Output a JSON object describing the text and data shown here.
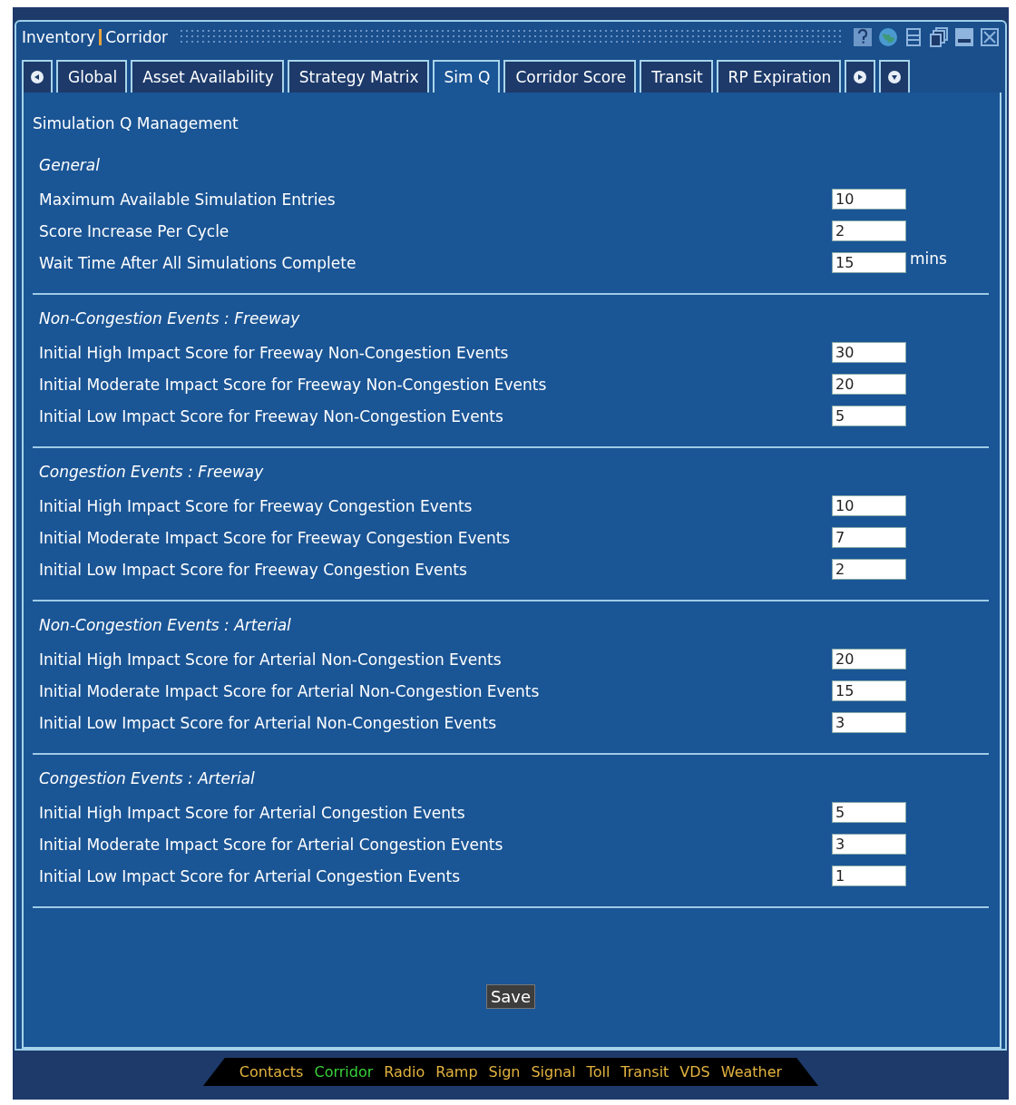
{
  "window": {
    "title": "Inventory",
    "subtitle": "Corridor"
  },
  "tabs": [
    {
      "label": "Global",
      "selected": false
    },
    {
      "label": "Asset Availability",
      "selected": false
    },
    {
      "label": "Strategy Matrix",
      "selected": false
    },
    {
      "label": "Sim Q",
      "selected": true
    },
    {
      "label": "Corridor Score",
      "selected": false
    },
    {
      "label": "Transit",
      "selected": false
    },
    {
      "label": "RP Expiration",
      "selected": false
    }
  ],
  "heading": "Simulation Q Management",
  "sections": [
    {
      "title": "General",
      "rows": [
        {
          "label": "Maximum Available Simulation Entries",
          "value": "10"
        },
        {
          "label": "Score Increase Per Cycle",
          "value": "2"
        },
        {
          "label": "Wait Time After All Simulations Complete",
          "value": "15",
          "unit": "mins"
        }
      ]
    },
    {
      "title": "Non-Congestion Events : Freeway",
      "rows": [
        {
          "label": "Initial High Impact Score for Freeway Non-Congestion Events",
          "value": "30"
        },
        {
          "label": "Initial Moderate Impact Score for Freeway Non-Congestion Events",
          "value": "20"
        },
        {
          "label": "Initial Low Impact Score for Freeway Non-Congestion Events",
          "value": "5"
        }
      ]
    },
    {
      "title": "Congestion Events : Freeway",
      "rows": [
        {
          "label": "Initial High Impact Score for Freeway Congestion Events",
          "value": "10"
        },
        {
          "label": "Initial Moderate Impact Score for Freeway Congestion Events",
          "value": "7"
        },
        {
          "label": "Initial Low Impact Score for Freeway Congestion Events",
          "value": "2"
        }
      ]
    },
    {
      "title": "Non-Congestion Events : Arterial",
      "rows": [
        {
          "label": "Initial High Impact Score for Arterial Non-Congestion Events",
          "value": "20"
        },
        {
          "label": "Initial Moderate Impact Score for Arterial Non-Congestion Events",
          "value": "15"
        },
        {
          "label": "Initial Low Impact Score for Arterial Non-Congestion Events",
          "value": "3"
        }
      ]
    },
    {
      "title": "Congestion Events : Arterial",
      "rows": [
        {
          "label": "Initial High Impact Score for Arterial Congestion Events",
          "value": "5"
        },
        {
          "label": "Initial Moderate Impact Score for Arterial Congestion Events",
          "value": "3"
        },
        {
          "label": "Initial Low Impact Score for Arterial Congestion Events",
          "value": "1"
        }
      ]
    }
  ],
  "save_button": "Save",
  "bottom_nav": [
    {
      "label": "Contacts",
      "selected": false
    },
    {
      "label": "Corridor",
      "selected": true
    },
    {
      "label": "Radio",
      "selected": false
    },
    {
      "label": "Ramp",
      "selected": false
    },
    {
      "label": "Sign",
      "selected": false
    },
    {
      "label": "Signal",
      "selected": false
    },
    {
      "label": "Toll",
      "selected": false
    },
    {
      "label": "Transit",
      "selected": false
    },
    {
      "label": "VDS",
      "selected": false
    },
    {
      "label": "Weather",
      "selected": false
    }
  ]
}
